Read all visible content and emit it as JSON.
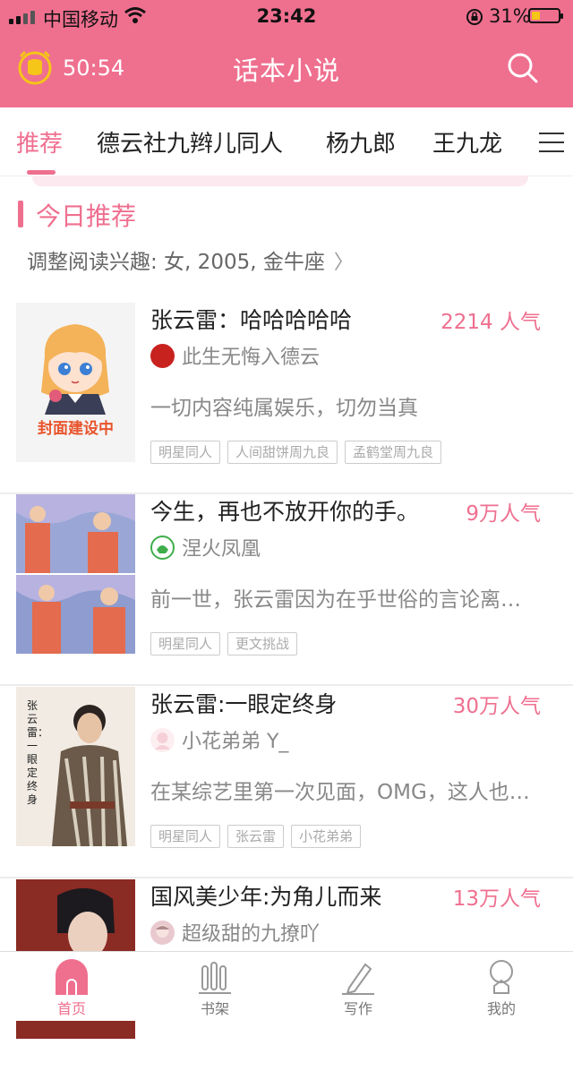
{
  "status": {
    "carrier": "中国移动",
    "time": "23:42",
    "battery": "31%",
    "battery_level": 0.31
  },
  "header": {
    "timer": "50:54",
    "title": "话本小说"
  },
  "tabs": [
    {
      "label": "推荐",
      "active": true
    },
    {
      "label": "德云社九辫儿同人"
    },
    {
      "label": "杨九郎"
    },
    {
      "label": "王九龙"
    }
  ],
  "section": {
    "title": "今日推荐",
    "interest": "调整阅读兴趣: 女, 2005, 金牛座"
  },
  "books": [
    {
      "title": "张云雷：哈哈哈哈哈",
      "popularity": "2214 人气",
      "author": "此生无悔入德云",
      "description": "一切内容纯属娱乐，切勿当真",
      "tags": [
        "明星同人",
        "人间甜饼周九良",
        "孟鹤堂周九良"
      ],
      "cover_text": "封面建设中"
    },
    {
      "title": "今生，再也不放开你的手。",
      "popularity": "9万人气",
      "author": "涅火凤凰",
      "description": "前一世，张云雷因为在乎世俗的言论离…",
      "tags": [
        "明星同人",
        "更文挑战"
      ]
    },
    {
      "title": "张云雷:一眼定终身",
      "popularity": "30万人气",
      "author": "小花弟弟 Y_",
      "description": "在某综艺里第一次见面，OMG，这人也…",
      "tags": [
        "明星同人",
        "张云雷",
        "小花弟弟"
      ],
      "cover_text": "张云雷：一眼定终身"
    },
    {
      "title": "国风美少年:为角儿而来",
      "popularity": "13万人气",
      "author": "超级甜的九撩吖"
    }
  ],
  "bottom_nav": [
    {
      "label": "首页",
      "icon": "home-icon",
      "active": true
    },
    {
      "label": "书架",
      "icon": "bookshelf-icon"
    },
    {
      "label": "写作",
      "icon": "pen-icon"
    },
    {
      "label": "我的",
      "icon": "profile-icon"
    }
  ],
  "colors": {
    "brand": "#ef6f8f",
    "text": "#222222",
    "muted": "#888888"
  }
}
